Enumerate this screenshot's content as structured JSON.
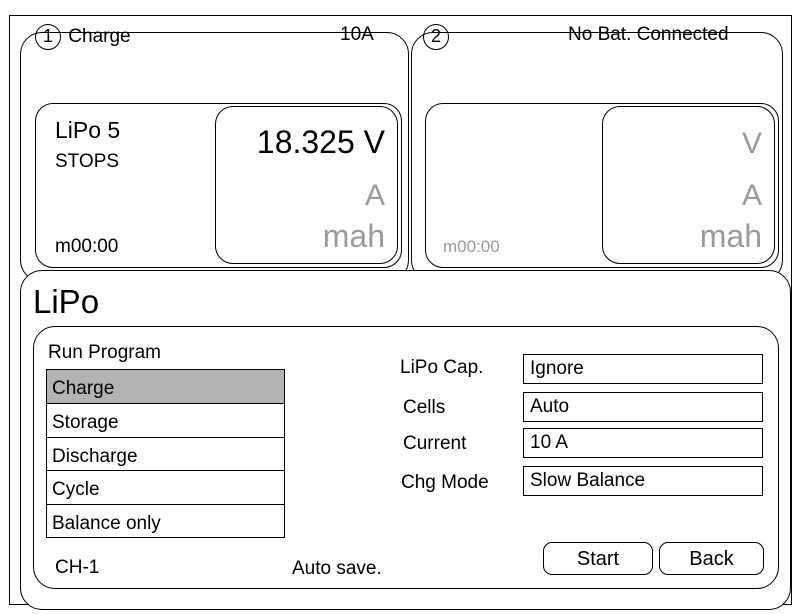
{
  "channel1": {
    "number": "1",
    "mode": "Charge",
    "current": "10A",
    "battery_type": "LiPo 5",
    "status": "STOPS",
    "timer": "m00:00",
    "voltage": "18.325 V",
    "amps": "A",
    "capacity": "mah"
  },
  "channel2": {
    "number": "2",
    "status": "No Bat. Connected",
    "timer": "m00:00",
    "voltage": "V",
    "amps": "A",
    "capacity": "mah"
  },
  "program_panel": {
    "title": "LiPo",
    "run_program_label": "Run Program",
    "programs": [
      "Charge",
      "Storage",
      "Discharge",
      "Cycle",
      "Balance only"
    ],
    "selected_program": "Charge",
    "params": {
      "lipo_cap": {
        "label": "LiPo Cap.",
        "value": "Ignore"
      },
      "cells": {
        "label": "Cells",
        "value": "Auto"
      },
      "current": {
        "label": "Current",
        "value": "10 A"
      },
      "chg_mode": {
        "label": "Chg Mode",
        "value": "Slow Balance"
      }
    },
    "channel_indicator": "CH-1",
    "autosave_text": "Auto save.",
    "start_label": "Start",
    "back_label": "Back"
  },
  "colors": {
    "selected_bg": "#b3b3b3",
    "muted_text": "#9a9a9a",
    "border": "#000000"
  }
}
